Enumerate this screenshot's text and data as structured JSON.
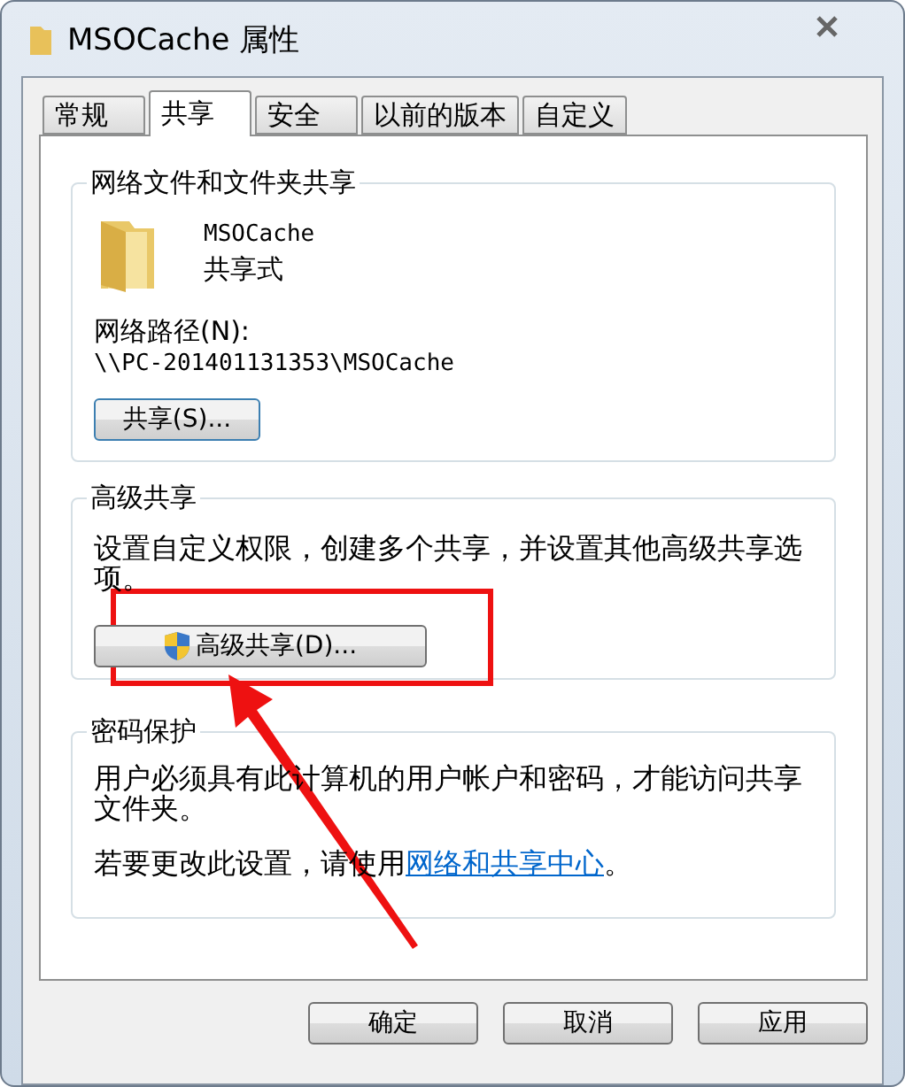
{
  "window": {
    "title": "MSOCache 属性"
  },
  "tabs": [
    {
      "label": "常规",
      "selected": false
    },
    {
      "label": "共享",
      "selected": true
    },
    {
      "label": "安全",
      "selected": false
    },
    {
      "label": "以前的版本",
      "selected": false
    },
    {
      "label": "自定义",
      "selected": false
    }
  ],
  "network_sharing": {
    "legend": "网络文件和文件夹共享",
    "item_name": "MSOCache",
    "item_status": "共享式",
    "path_label": "网络路径(N):",
    "path": "\\\\PC-201401131353\\MSOCache",
    "button": "共享(S)..."
  },
  "advanced_sharing": {
    "legend": "高级共享",
    "description": "设置自定义权限，创建多个共享，并设置其他高级共享选项。",
    "button": "高级共享(D)..."
  },
  "password_protection": {
    "legend": "密码保护",
    "description": "用户必须具有此计算机的用户帐户和密码，才能访问共享文件夹。",
    "hint_before": "若要更改此设置，请使用",
    "hint_link": "网络和共享中心",
    "hint_after": "。"
  },
  "buttons": [
    {
      "label": "确定"
    },
    {
      "label": "取消"
    },
    {
      "label": "应用"
    }
  ]
}
